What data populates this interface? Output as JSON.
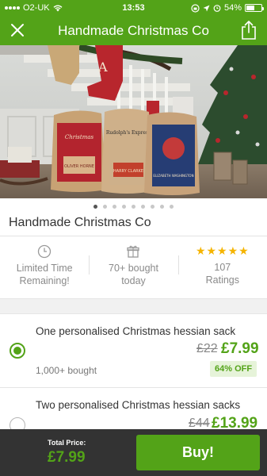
{
  "status_bar": {
    "carrier": "O2-UK",
    "time": "13:53",
    "battery": "54%",
    "battery_level": 0.54
  },
  "navbar": {
    "title": "Handmade Christmas Co",
    "close_icon": "close-icon",
    "share_icon": "share-icon"
  },
  "gallery": {
    "sacks": [
      {
        "top_text": "Christmas",
        "name": "OLIVER HORNE"
      },
      {
        "top_text": "Rudolph's Express",
        "name": "HARRY CLARKE"
      },
      {
        "top_text": "",
        "name": "ELIZABETH WASHINGTON"
      }
    ],
    "stocking_letter": "A",
    "dot_count": 9,
    "active_dot": 0
  },
  "deal": {
    "title": "Handmade Christmas Co"
  },
  "info": {
    "limited": "Limited Time Remaining!",
    "bought": "70+ bought today",
    "stars": "★★★★★",
    "ratings_count": "107",
    "ratings_label": "Ratings"
  },
  "options": [
    {
      "name": "One personalised Christmas hessian sack",
      "sub": "1,000+ bought",
      "old_price": "£22",
      "new_price": "£7.99",
      "badge": "64% OFF",
      "selected": true
    },
    {
      "name": "Two personalised Christmas hessian sacks",
      "old_price": "£44",
      "new_price": "£13.99",
      "selected": false
    }
  ],
  "footer": {
    "total_label": "Total Price:",
    "total_value": "£7.99",
    "buy_label": "Buy!"
  },
  "colors": {
    "brand": "#53a318",
    "footer_bg": "#333333"
  }
}
